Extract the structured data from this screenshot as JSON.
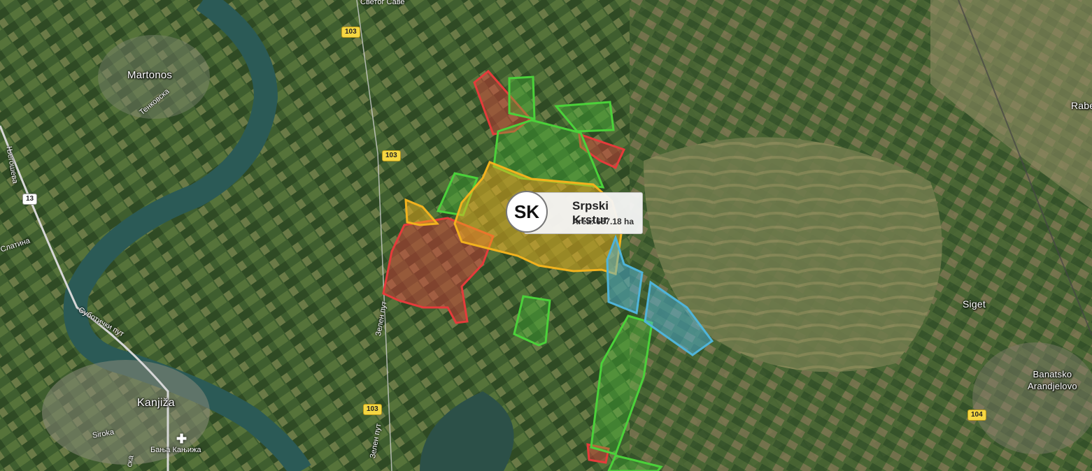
{
  "popup": {
    "initials": "SK",
    "title": "Srpski Krstur",
    "area_label": "Area: 657.18 ha"
  },
  "places": [
    {
      "id": "martonos",
      "label": "Martonos"
    },
    {
      "id": "kanjiza",
      "label": "Kanjiža"
    },
    {
      "id": "siget",
      "label": "Siget"
    },
    {
      "id": "banatsko",
      "label": "Banatsko\nArandjelovo"
    },
    {
      "id": "rabe",
      "label": "Rabe"
    }
  ],
  "streets": {
    "svetog_save": "Светог Саве",
    "tenkovska": "Тенковска",
    "njegoseva": "Његошева",
    "slatina": "Слатина",
    "suboticki_put": "Суботички пут",
    "zelen_put_1": "Зелен пут",
    "zelen_put_2": "Зелен пут",
    "siroka": "Siroka",
    "banja": "Бања Кањижа",
    "ska": "ска"
  },
  "road_shields": {
    "r103a": "103",
    "r103b": "103",
    "r103c": "103",
    "r13": "13",
    "r104": "104"
  },
  "colors": {
    "green": "#4bd13a",
    "red": "#e53b3b",
    "orange": "#f2b21e",
    "blue": "#4fb4da"
  }
}
